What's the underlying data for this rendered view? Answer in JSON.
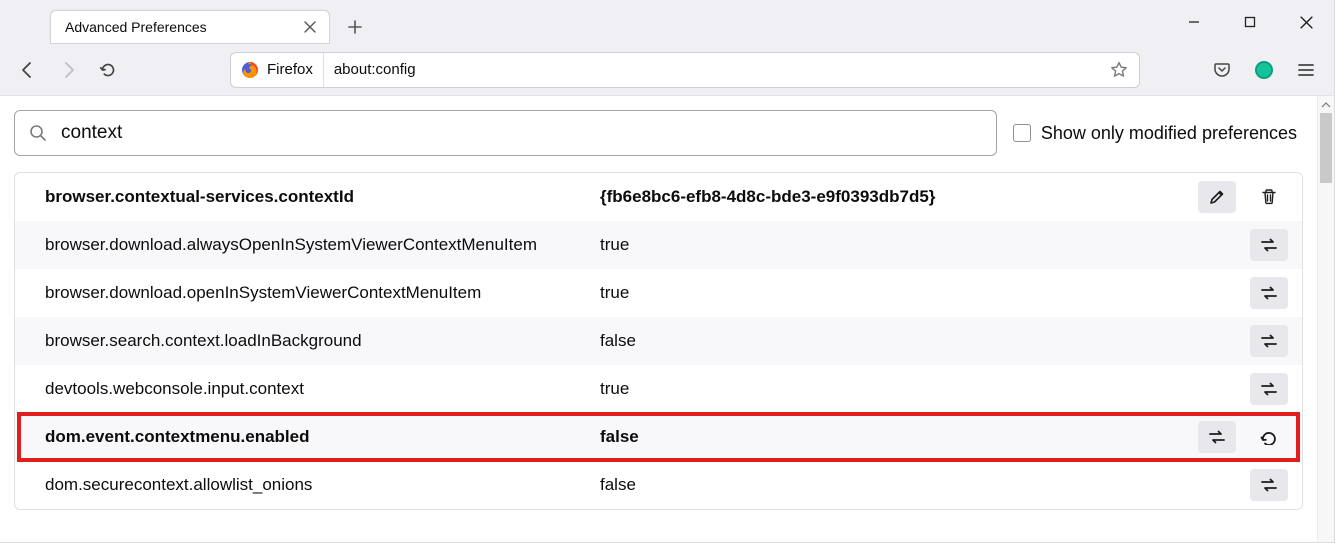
{
  "tab": {
    "title": "Advanced Preferences"
  },
  "urlbar": {
    "identity": "Firefox",
    "url": "about:config"
  },
  "search": {
    "value": "context",
    "checkbox_label": "Show only modified preferences"
  },
  "prefs": [
    {
      "name": "browser.contextual-services.contextId",
      "value": "{fb6e8bc6-efb8-4d8c-bde3-e9f0393db7d5}",
      "bold": true,
      "actions": [
        "edit",
        "delete"
      ]
    },
    {
      "name": "browser.download.alwaysOpenInSystemViewerContextMenuItem",
      "value": "true",
      "actions": [
        "toggle"
      ]
    },
    {
      "name": "browser.download.openInSystemViewerContextMenuItem",
      "value": "true",
      "actions": [
        "toggle"
      ]
    },
    {
      "name": "browser.search.context.loadInBackground",
      "value": "false",
      "actions": [
        "toggle"
      ]
    },
    {
      "name": "devtools.webconsole.input.context",
      "value": "true",
      "actions": [
        "toggle"
      ]
    },
    {
      "name": "dom.event.contextmenu.enabled",
      "value": "false",
      "bold": true,
      "highlight": true,
      "actions": [
        "toggle",
        "reset"
      ]
    },
    {
      "name": "dom.securecontext.allowlist_onions",
      "value": "false",
      "actions": [
        "toggle"
      ]
    }
  ]
}
